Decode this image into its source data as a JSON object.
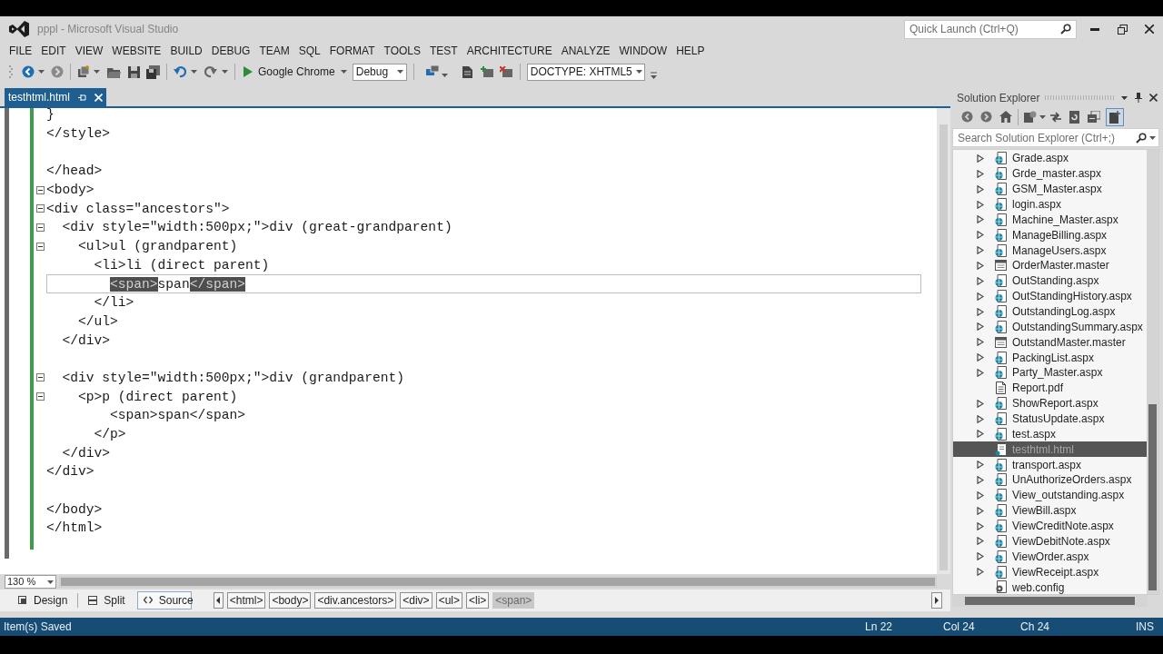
{
  "window": {
    "title": "pppl - Microsoft Visual Studio"
  },
  "quick_launch": {
    "placeholder": "Quick Launch (Ctrl+Q)"
  },
  "menu": [
    "FILE",
    "EDIT",
    "VIEW",
    "WEBSITE",
    "BUILD",
    "DEBUG",
    "TEAM",
    "SQL",
    "FORMAT",
    "TOOLS",
    "TEST",
    "ARCHITECTURE",
    "ANALYZE",
    "WINDOW",
    "HELP"
  ],
  "toolbar": {
    "browser": "Google Chrome",
    "configuration": "Debug",
    "doctype": "DOCTYPE: XHTML5"
  },
  "document_tabs": [
    {
      "label": "testhtml.html",
      "selected": true
    }
  ],
  "editor": {
    "lines": [
      {
        "kind": "code",
        "text": "}",
        "current": false
      },
      {
        "kind": "code",
        "text": "</style>",
        "current": false
      },
      {
        "kind": "blank"
      },
      {
        "kind": "code",
        "text": "</head>",
        "current": false
      },
      {
        "kind": "code",
        "text": "<body>",
        "expanded": true,
        "current": false
      },
      {
        "kind": "code",
        "text": "<div class=\"ancestors\">",
        "expanded": true,
        "current": false
      },
      {
        "kind": "code",
        "text": "  <div style=\"width:500px;\">div (great-grandparent)",
        "expanded": true,
        "current": false
      },
      {
        "kind": "code",
        "text": "    <ul>ul (grandparent)",
        "expanded": true,
        "current": false
      },
      {
        "kind": "code",
        "text": "      <li>li (direct parent)",
        "current": false
      },
      {
        "kind": "code",
        "segments": [
          {
            "text": "        <span>",
            "highlighted": true
          },
          {
            "text": "span",
            "highlighted": false
          },
          {
            "text": "</span>",
            "highlighted": true
          }
        ],
        "current": true
      },
      {
        "kind": "code",
        "text": "      </li>",
        "current": false
      },
      {
        "kind": "code",
        "text": "    </ul>",
        "current": false
      },
      {
        "kind": "code",
        "text": "  </div>",
        "current": false
      },
      {
        "kind": "blank"
      },
      {
        "kind": "code",
        "text": "  <div style=\"width:500px;\">div (grandparent)",
        "expanded": true,
        "current": false
      },
      {
        "kind": "code",
        "text": "    <p>p (direct parent)",
        "expanded": true,
        "current": false
      },
      {
        "kind": "code",
        "text": "        <span>span</span>",
        "current": false
      },
      {
        "kind": "code",
        "text": "      </p>",
        "current": false
      },
      {
        "kind": "code",
        "text": "  </div>",
        "current": false
      },
      {
        "kind": "code",
        "text": "</div>",
        "current": false
      },
      {
        "kind": "blank"
      },
      {
        "kind": "code",
        "text": "</body>",
        "current": false
      },
      {
        "kind": "code",
        "text": "</html>",
        "current": false
      }
    ]
  },
  "zoom": "130 %",
  "view_tabs": [
    {
      "label": "Design",
      "kind": "design",
      "selected": false
    },
    {
      "label": "Split",
      "kind": "split",
      "selected": false
    },
    {
      "label": "Source",
      "kind": "source",
      "selected": true
    }
  ],
  "tag_path": [
    {
      "label": "<html>",
      "selected": false
    },
    {
      "label": "<body>",
      "selected": false
    },
    {
      "label": "<div.ancestors>",
      "selected": false
    },
    {
      "label": "<div>",
      "selected": false
    },
    {
      "label": "<ul>",
      "selected": false
    },
    {
      "label": "<li>",
      "selected": false
    },
    {
      "label": "<span>",
      "selected": true
    }
  ],
  "solution_explorer": {
    "title": "Solution Explorer",
    "toggle_button": {
      "on": true
    },
    "search": {
      "placeholder": "Search Solution Explorer (Ctrl+;)"
    },
    "items": [
      {
        "label": "Grade.aspx",
        "kind": "aspx",
        "expanded": false,
        "selected": false
      },
      {
        "label": "Grde_master.aspx",
        "kind": "aspx",
        "expanded": false,
        "selected": false
      },
      {
        "label": "GSM_Master.aspx",
        "kind": "aspx",
        "expanded": false,
        "selected": false
      },
      {
        "label": "login.aspx",
        "kind": "aspx",
        "expanded": false,
        "selected": false
      },
      {
        "label": "Machine_Master.aspx",
        "kind": "aspx",
        "expanded": false,
        "selected": false
      },
      {
        "label": "ManageBilling.aspx",
        "kind": "aspx",
        "expanded": false,
        "selected": false
      },
      {
        "label": "ManageUsers.aspx",
        "kind": "aspx",
        "expanded": false,
        "selected": false
      },
      {
        "label": "OrderMaster.master",
        "kind": "master",
        "expanded": false,
        "selected": false
      },
      {
        "label": "OutStanding.aspx",
        "kind": "aspx",
        "expanded": false,
        "selected": false
      },
      {
        "label": "OutStandingHistory.aspx",
        "kind": "aspx",
        "expanded": false,
        "selected": false
      },
      {
        "label": "OutstandingLog.aspx",
        "kind": "aspx",
        "expanded": false,
        "selected": false
      },
      {
        "label": "OutstandingSummary.aspx",
        "kind": "aspx",
        "expanded": false,
        "selected": false
      },
      {
        "label": "OutstandMaster.master",
        "kind": "master",
        "expanded": false,
        "selected": false
      },
      {
        "label": "PackingList.aspx",
        "kind": "aspx",
        "expanded": false,
        "selected": false
      },
      {
        "label": "Party_Master.aspx",
        "kind": "aspx",
        "expanded": false,
        "selected": false
      },
      {
        "label": "Report.pdf",
        "kind": "pdf",
        "selected": false
      },
      {
        "label": "ShowReport.aspx",
        "kind": "aspx",
        "expanded": false,
        "selected": false
      },
      {
        "label": "StatusUpdate.aspx",
        "kind": "aspx",
        "expanded": false,
        "selected": false
      },
      {
        "label": "test.aspx",
        "kind": "aspx",
        "expanded": false,
        "selected": false
      },
      {
        "label": "testhtml.html",
        "kind": "html",
        "selected": true
      },
      {
        "label": "transport.aspx",
        "kind": "aspx",
        "expanded": false,
        "selected": false
      },
      {
        "label": "UnAuthorizeOrders.aspx",
        "kind": "aspx",
        "expanded": false,
        "selected": false
      },
      {
        "label": "View_outstanding.aspx",
        "kind": "aspx",
        "expanded": false,
        "selected": false
      },
      {
        "label": "ViewBill.aspx",
        "kind": "aspx",
        "expanded": false,
        "selected": false
      },
      {
        "label": "ViewCreditNote.aspx",
        "kind": "aspx",
        "expanded": false,
        "selected": false
      },
      {
        "label": "ViewDebitNote.aspx",
        "kind": "aspx",
        "expanded": false,
        "selected": false
      },
      {
        "label": "ViewOrder.aspx",
        "kind": "aspx",
        "expanded": false,
        "selected": false
      },
      {
        "label": "ViewReceipt.aspx",
        "kind": "aspx",
        "expanded": false,
        "selected": false
      },
      {
        "label": "web.config",
        "kind": "config",
        "selected": false
      }
    ]
  },
  "status_bar": {
    "message": "Item(s) Saved",
    "line": "Ln 22",
    "column": "Col 24",
    "char": "Ch 24",
    "mode": "INS"
  }
}
